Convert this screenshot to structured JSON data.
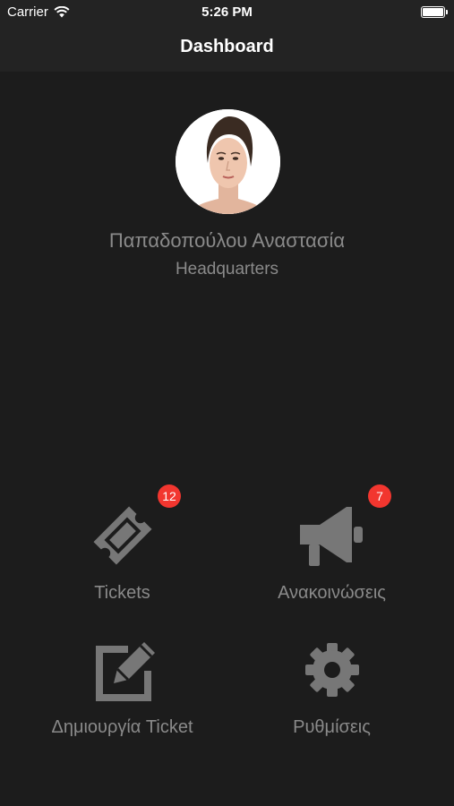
{
  "status_bar": {
    "carrier": "Carrier",
    "time": "5:26 PM"
  },
  "nav": {
    "title": "Dashboard"
  },
  "profile": {
    "name": "Παπαδοπούλου Αναστασία",
    "location": "Headquarters"
  },
  "menu": [
    {
      "label": "Tickets",
      "icon": "ticket-icon",
      "badge": "12"
    },
    {
      "label": "Ανακοινώσεις",
      "icon": "megaphone-icon",
      "badge": "7"
    },
    {
      "label": "Δημιουργία Ticket",
      "icon": "edit-icon"
    },
    {
      "label": "Ρυθμίσεις",
      "icon": "gear-icon"
    }
  ],
  "colors": {
    "background": "#1c1c1c",
    "bar": "#232323",
    "icon": "#777777",
    "badge": "#f2362f"
  }
}
